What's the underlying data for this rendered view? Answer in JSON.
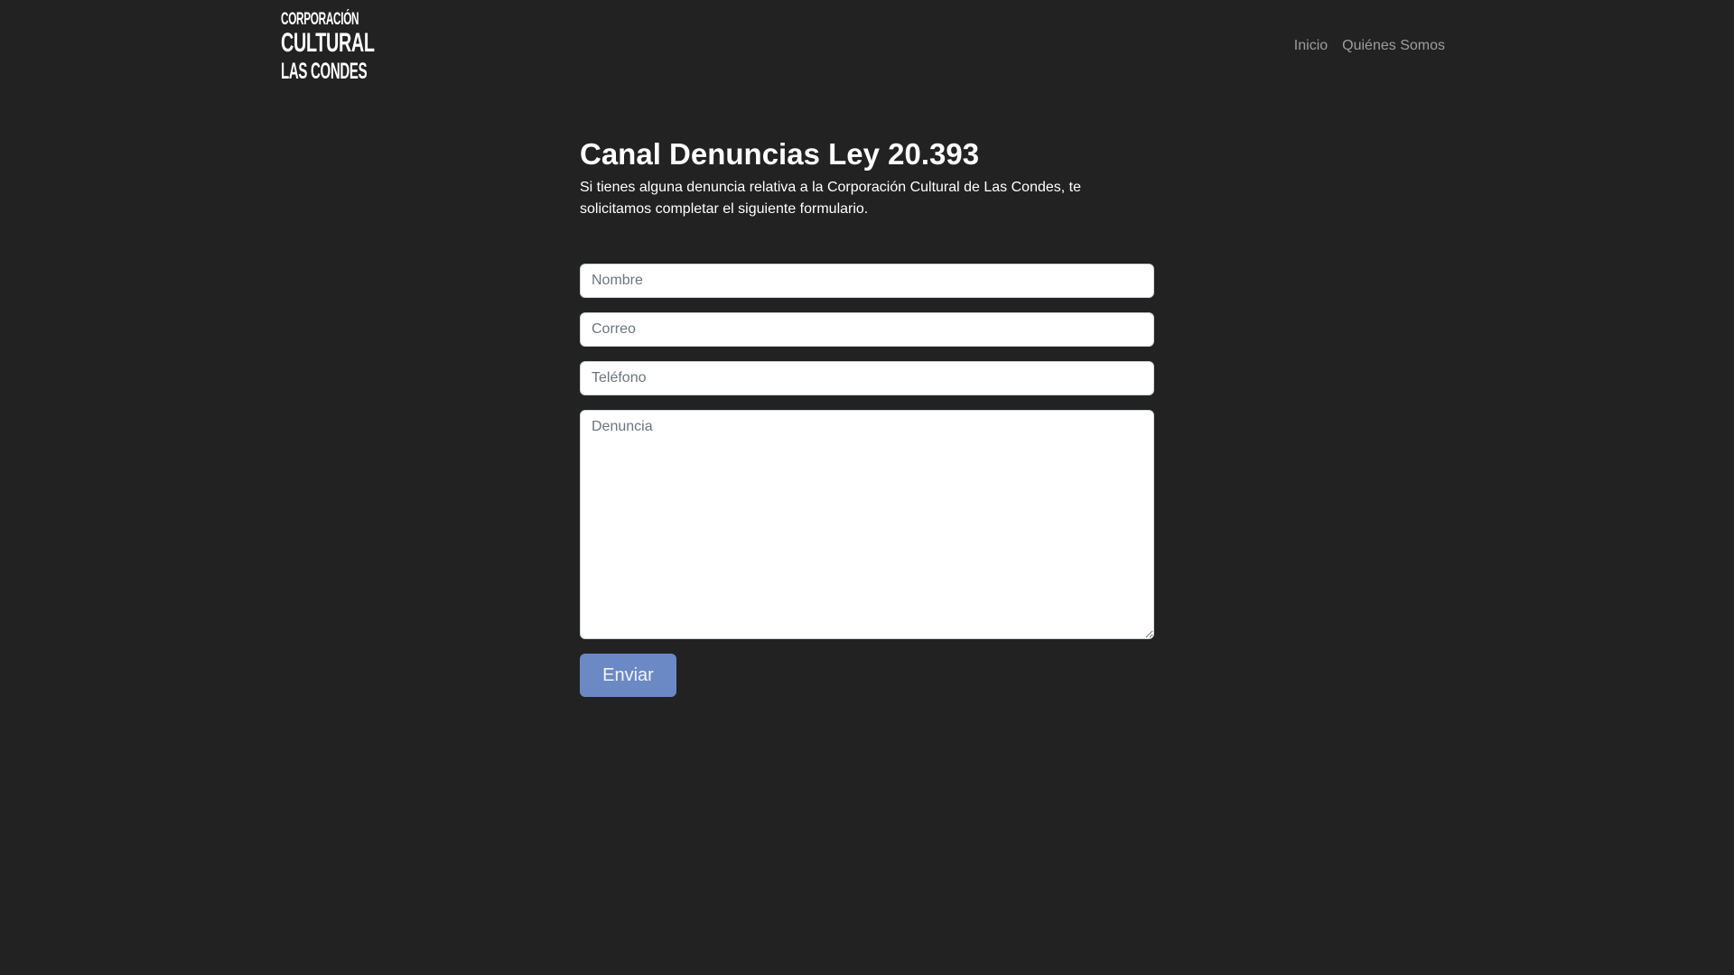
{
  "header": {
    "logo_lines": [
      "CORPORACIÓN",
      "CULTURAL",
      "LAS CONDES"
    ],
    "nav": [
      {
        "label": "Inicio"
      },
      {
        "label": "Quiénes Somos"
      }
    ]
  },
  "main": {
    "title": "Canal Denuncias Ley 20.393",
    "intro": "Si tienes alguna denuncia relativa a la Corporación Cultural de Las Condes, te solicitamos completar el siguiente formulario.",
    "form": {
      "name_placeholder": "Nombre",
      "email_placeholder": "Correo",
      "phone_placeholder": "Teléfono",
      "complaint_placeholder": "Denuncia",
      "submit_label": "Enviar"
    }
  },
  "colors": {
    "background": "#222222",
    "text": "#ffffff",
    "nav_link": "#9a9a9a",
    "button": "#6f8fcd"
  }
}
